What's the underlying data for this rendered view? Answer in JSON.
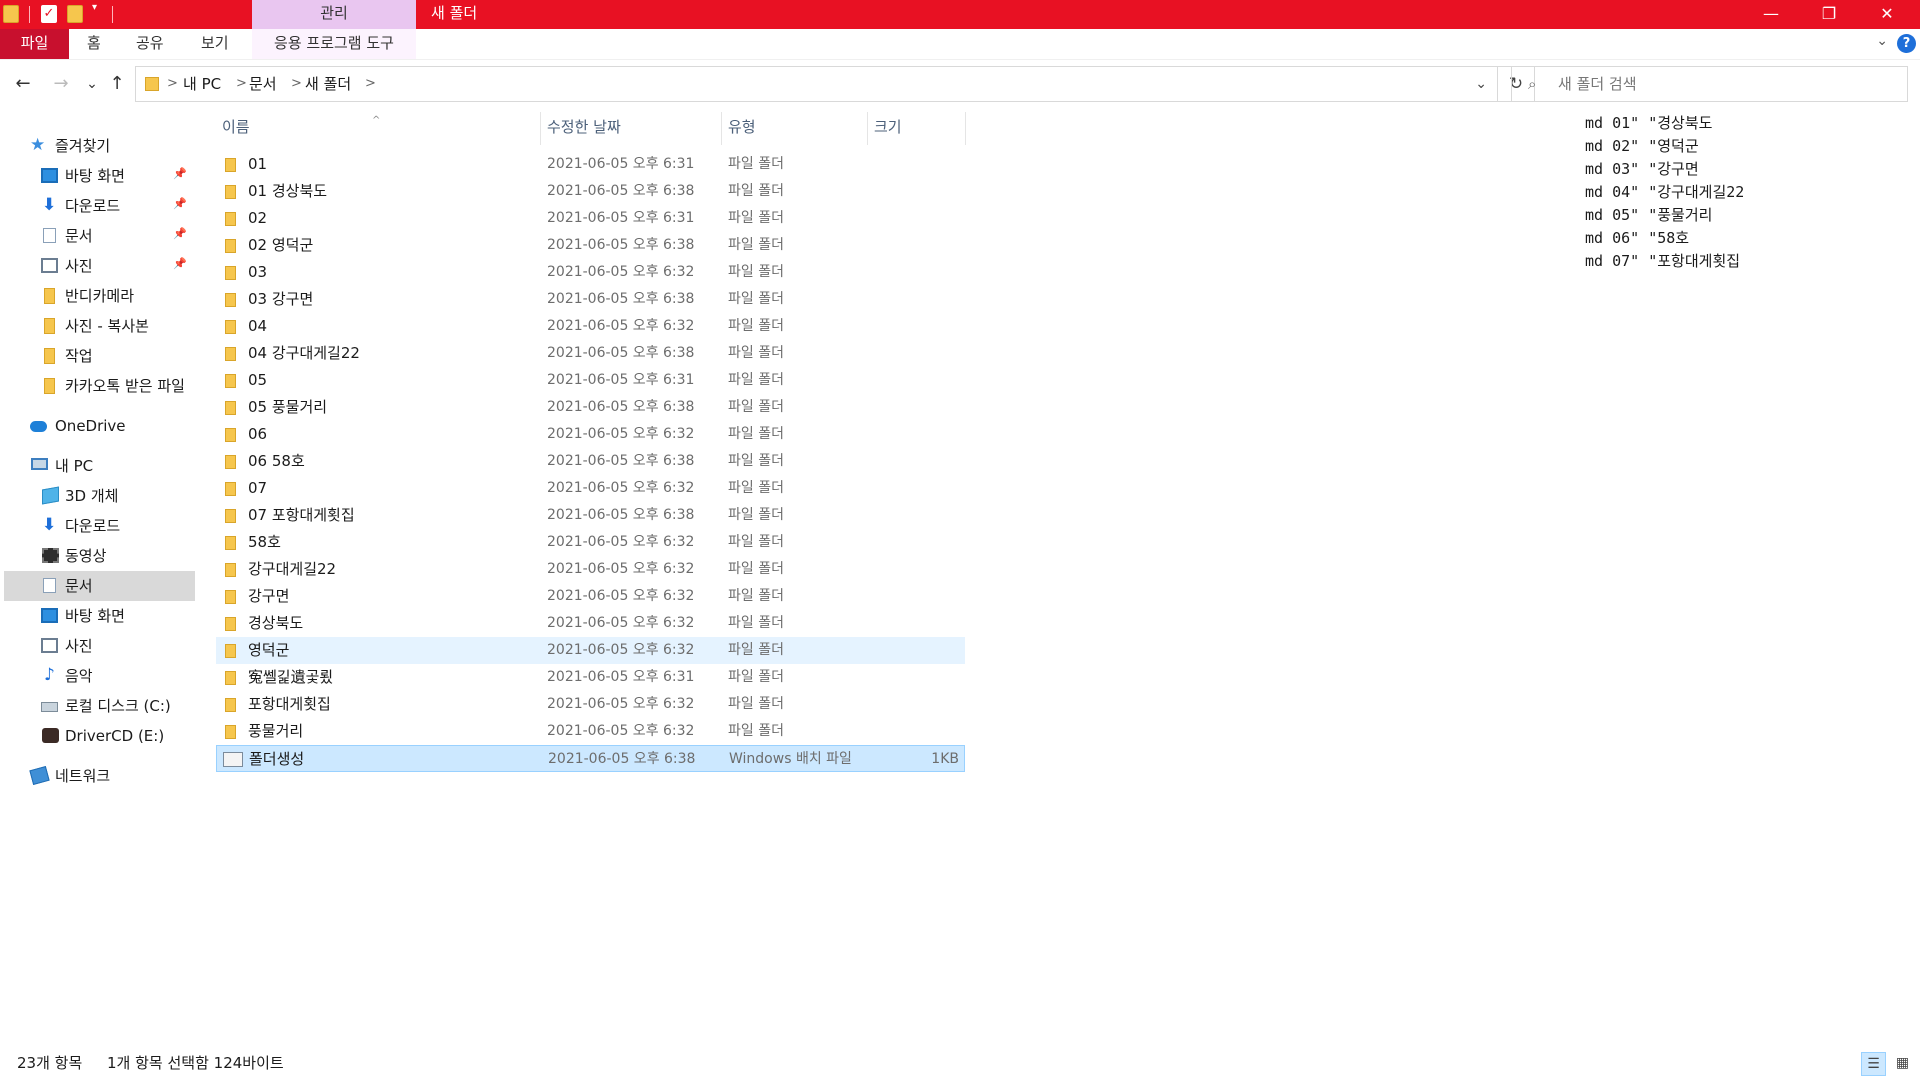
{
  "titlebar": {
    "context_tab": "관리",
    "window_title": "새 폴더",
    "minimize_glyph": "—",
    "restore_glyph": "❐",
    "close_glyph": "✕"
  },
  "ribbon": {
    "tabs": [
      "파일",
      "홈",
      "공유",
      "보기",
      "응용 프로그램 도구"
    ],
    "help_glyph": "?"
  },
  "nav": {
    "back_glyph": "←",
    "forward_glyph": "→",
    "history_glyph": "⌄",
    "up_glyph": "↑",
    "breadcrumb": [
      "내 PC",
      "문서",
      "새 폴더"
    ],
    "refresh_glyph": "↻"
  },
  "search": {
    "placeholder": "새 폴더 검색"
  },
  "sidebar": {
    "quick_access": "즐겨찾기",
    "quick_items": [
      {
        "label": "바탕 화면",
        "icon": "desktop-icon",
        "pinned": true
      },
      {
        "label": "다운로드",
        "icon": "download-icon",
        "pinned": true
      },
      {
        "label": "문서",
        "icon": "document-icon",
        "pinned": true
      },
      {
        "label": "사진",
        "icon": "pictures-icon",
        "pinned": true
      },
      {
        "label": "반디카메라",
        "icon": "folder-icon",
        "pinned": false
      },
      {
        "label": "사진 - 복사본",
        "icon": "folder-icon",
        "pinned": false
      },
      {
        "label": "작업",
        "icon": "folder-icon",
        "pinned": false
      },
      {
        "label": "카카오톡 받은 파일",
        "icon": "folder-icon",
        "pinned": false
      }
    ],
    "onedrive": "OneDrive",
    "this_pc": "내 PC",
    "pc_items": [
      {
        "label": "3D 개체",
        "icon": "3d-objects-icon"
      },
      {
        "label": "다운로드",
        "icon": "download-icon"
      },
      {
        "label": "동영상",
        "icon": "videos-icon"
      },
      {
        "label": "문서",
        "icon": "document-icon",
        "selected": true
      },
      {
        "label": "바탕 화면",
        "icon": "desktop-icon"
      },
      {
        "label": "사진",
        "icon": "pictures-icon"
      },
      {
        "label": "음악",
        "icon": "music-icon"
      },
      {
        "label": "로컬 디스크 (C:)",
        "icon": "disk-icon"
      },
      {
        "label": "DriverCD (E:)",
        "icon": "cd-drive-icon"
      }
    ],
    "network": "네트워크"
  },
  "columns": {
    "name": "이름",
    "date": "수정한 날짜",
    "type": "유형",
    "size": "크기"
  },
  "files": [
    {
      "name": "01",
      "date": "2021-06-05 오후 6:31",
      "type": "파일 폴더",
      "size": "",
      "kind": "folder"
    },
    {
      "name": "01 경상북도",
      "date": "2021-06-05 오후 6:38",
      "type": "파일 폴더",
      "size": "",
      "kind": "folder"
    },
    {
      "name": "02",
      "date": "2021-06-05 오후 6:31",
      "type": "파일 폴더",
      "size": "",
      "kind": "folder"
    },
    {
      "name": "02 영덕군",
      "date": "2021-06-05 오후 6:38",
      "type": "파일 폴더",
      "size": "",
      "kind": "folder"
    },
    {
      "name": "03",
      "date": "2021-06-05 오후 6:32",
      "type": "파일 폴더",
      "size": "",
      "kind": "folder"
    },
    {
      "name": "03 강구면",
      "date": "2021-06-05 오후 6:38",
      "type": "파일 폴더",
      "size": "",
      "kind": "folder"
    },
    {
      "name": "04",
      "date": "2021-06-05 오후 6:32",
      "type": "파일 폴더",
      "size": "",
      "kind": "folder"
    },
    {
      "name": "04 강구대게길22",
      "date": "2021-06-05 오후 6:38",
      "type": "파일 폴더",
      "size": "",
      "kind": "folder"
    },
    {
      "name": "05",
      "date": "2021-06-05 오후 6:31",
      "type": "파일 폴더",
      "size": "",
      "kind": "folder"
    },
    {
      "name": "05 풍물거리",
      "date": "2021-06-05 오후 6:38",
      "type": "파일 폴더",
      "size": "",
      "kind": "folder"
    },
    {
      "name": "06",
      "date": "2021-06-05 오후 6:32",
      "type": "파일 폴더",
      "size": "",
      "kind": "folder"
    },
    {
      "name": "06 58호",
      "date": "2021-06-05 오후 6:38",
      "type": "파일 폴더",
      "size": "",
      "kind": "folder"
    },
    {
      "name": "07",
      "date": "2021-06-05 오후 6:32",
      "type": "파일 폴더",
      "size": "",
      "kind": "folder"
    },
    {
      "name": "07 포항대게횟집",
      "date": "2021-06-05 오후 6:38",
      "type": "파일 폴더",
      "size": "",
      "kind": "folder"
    },
    {
      "name": "58호",
      "date": "2021-06-05 오후 6:32",
      "type": "파일 폴더",
      "size": "",
      "kind": "folder"
    },
    {
      "name": "강구대게길22",
      "date": "2021-06-05 오후 6:32",
      "type": "파일 폴더",
      "size": "",
      "kind": "folder"
    },
    {
      "name": "강구면",
      "date": "2021-06-05 오후 6:32",
      "type": "파일 폴더",
      "size": "",
      "kind": "folder"
    },
    {
      "name": "경상북도",
      "date": "2021-06-05 오후 6:32",
      "type": "파일 폴더",
      "size": "",
      "kind": "folder"
    },
    {
      "name": "영덕군",
      "date": "2021-06-05 오후 6:32",
      "type": "파일 폴더",
      "size": "",
      "kind": "folder",
      "hover": true
    },
    {
      "name": "寃쎌긽遺곷룄",
      "date": "2021-06-05 오후 6:31",
      "type": "파일 폴더",
      "size": "",
      "kind": "folder"
    },
    {
      "name": "포항대게횟집",
      "date": "2021-06-05 오후 6:32",
      "type": "파일 폴더",
      "size": "",
      "kind": "folder"
    },
    {
      "name": "풍물거리",
      "date": "2021-06-05 오후 6:32",
      "type": "파일 폴더",
      "size": "",
      "kind": "folder"
    },
    {
      "name": "폴더생성",
      "date": "2021-06-05 오후 6:38",
      "type": "Windows 배치 파일",
      "size": "1KB",
      "kind": "batch",
      "selected": true
    }
  ],
  "preview_lines": [
    "md 01\" \"경상북도",
    "md 02\" \"영덕군",
    "md 03\" \"강구면",
    "md 04\" \"강구대게길22",
    "md 05\" \"풍물거리",
    "md 06\" \"58호",
    "md 07\" \"포항대게횟집"
  ],
  "status": {
    "item_count": "23개 항목",
    "selection": "1개 항목 선택함 124바이트"
  },
  "colors": {
    "titlebar": "#e81123",
    "file_tab": "#c8102e",
    "context_tab": "#e9c6f0",
    "selection": "#cce8ff",
    "hover": "#e5f3ff"
  }
}
